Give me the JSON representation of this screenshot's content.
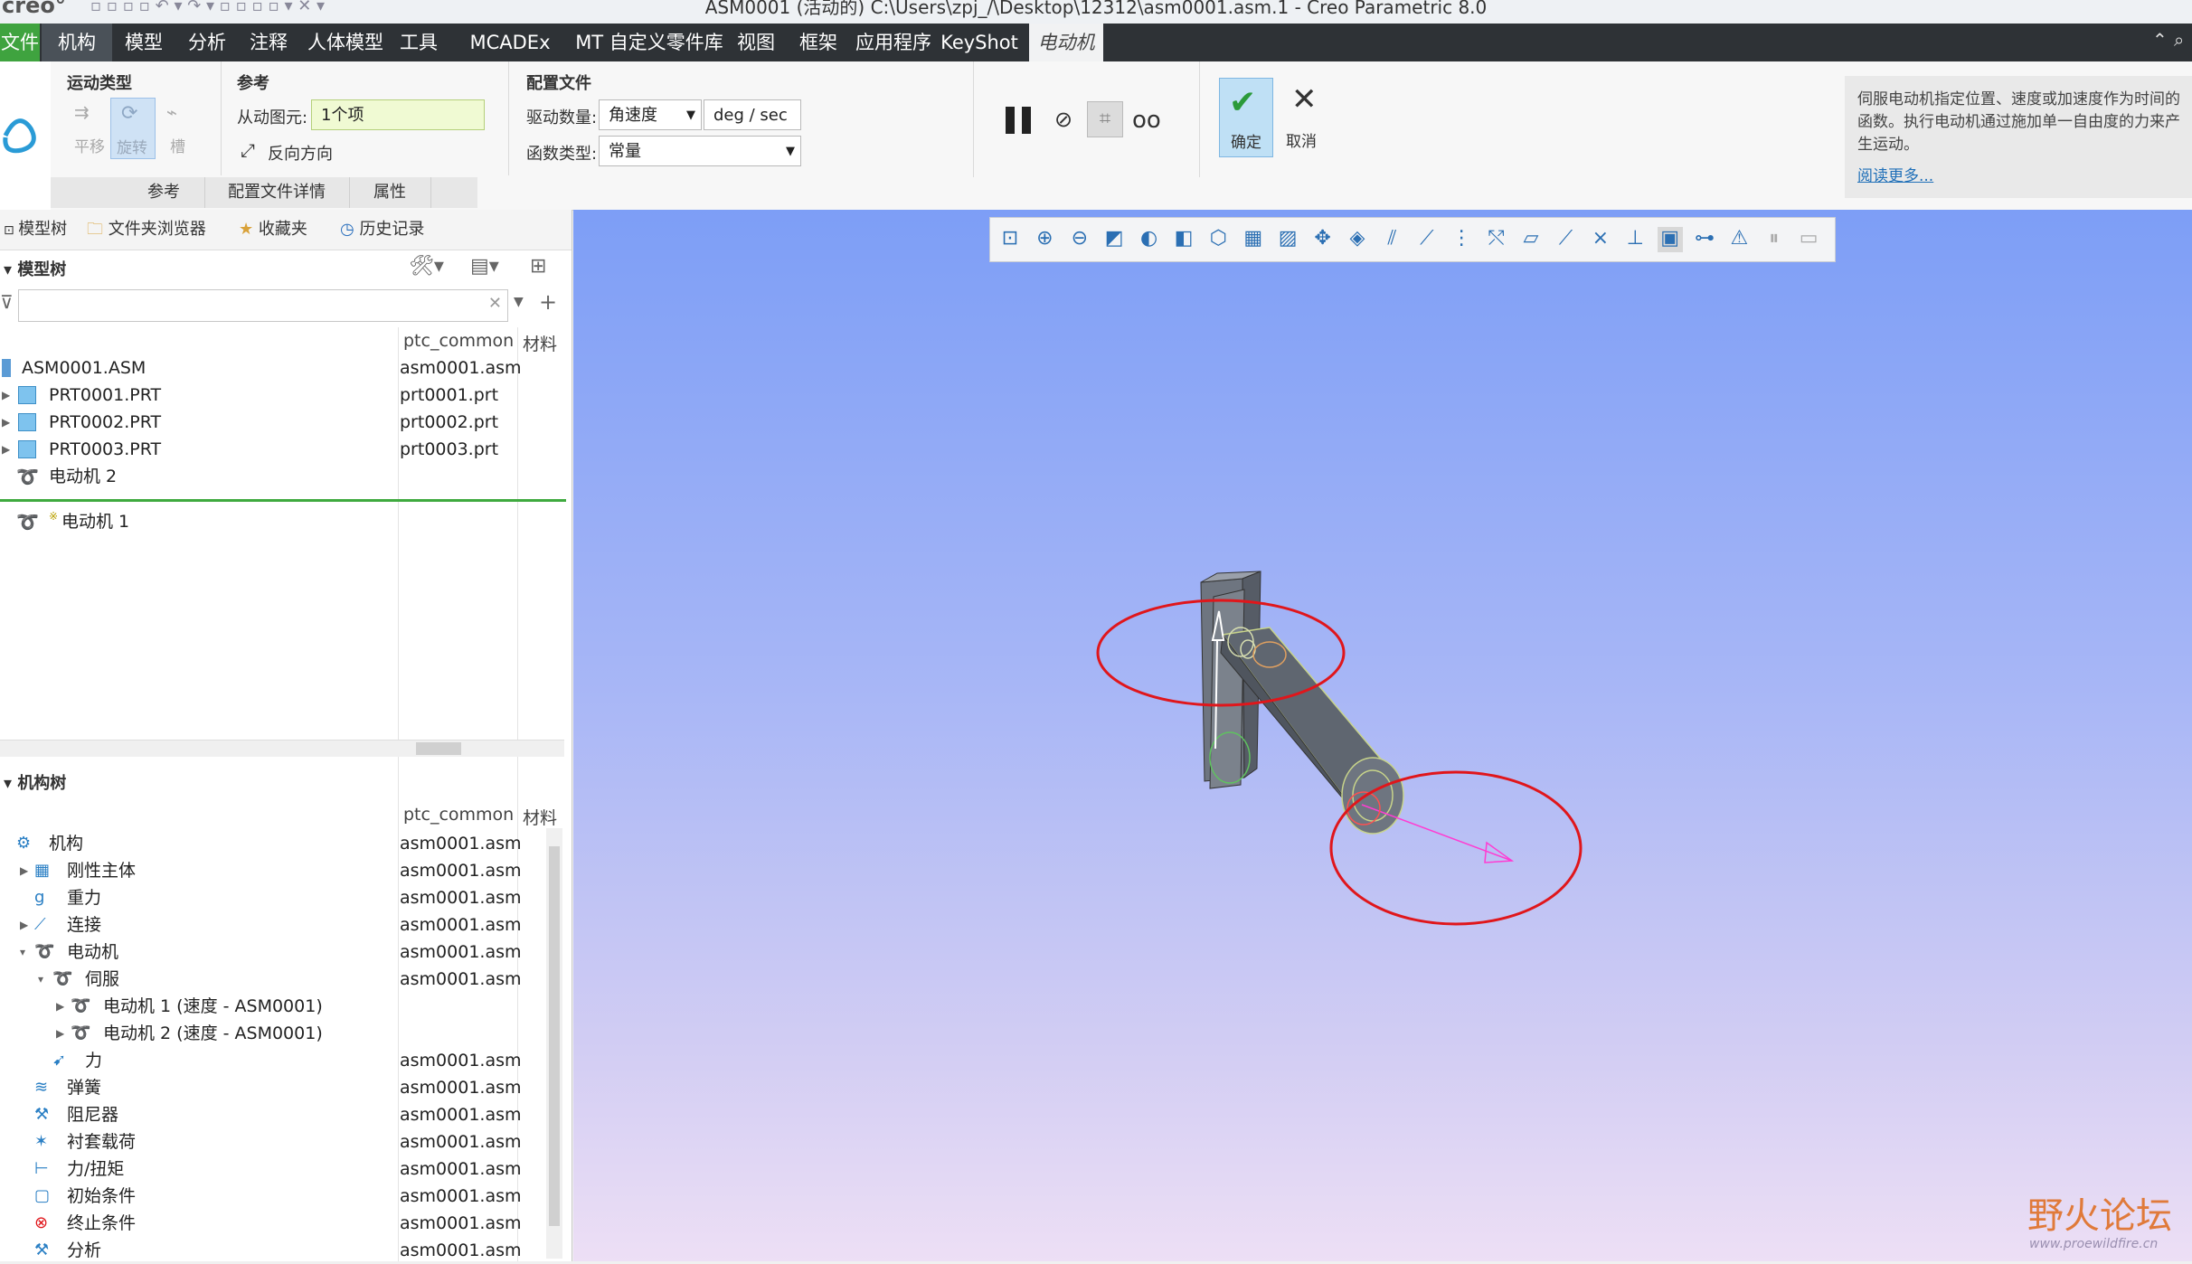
{
  "app": {
    "logo": "creo°",
    "window_title": "ASM0001 (活动的) C:\\Users\\zpj_/\\Desktop\\12312\\asm0001.asm.1 - Creo Parametric 8.0"
  },
  "menu": {
    "file": "文件",
    "items": [
      "机构",
      "模型",
      "分析",
      "注释",
      "人体模型",
      "工具",
      "MCADEx Tools",
      "MT 自定义零件库工具",
      "视图",
      "框架",
      "应用程序",
      "KeyShot"
    ],
    "active_tab": "电动机"
  },
  "ribbon": {
    "motion_type": {
      "title": "运动类型",
      "translate": "平移",
      "rotate": "旋转",
      "slot": "槽"
    },
    "reference": {
      "title": "参考",
      "driven_label": "从动图元:",
      "driven_value": "1个项",
      "reverse": "反向方向"
    },
    "profile": {
      "title": "配置文件",
      "drive_qty_label": "驱动数量:",
      "drive_qty_value": "角速度",
      "unit": "deg / sec",
      "func_type_label": "函数类型:",
      "func_type_value": "常量"
    },
    "ok": "确定",
    "cancel": "取消",
    "bottom_tabs": [
      "参考",
      "配置文件详情",
      "属性"
    ]
  },
  "help": {
    "text": "伺服电动机指定位置、速度或加速度作为时间的函数。执行电动机通过施加单一自由度的力来产生运动。",
    "link": "阅读更多..."
  },
  "nav_tabs": [
    "模型树",
    "文件夹浏览器",
    "收藏夹",
    "历史记录"
  ],
  "model_tree": {
    "title": "模型树",
    "columns": [
      "ptc_common",
      "材料"
    ],
    "rows": [
      {
        "name": "ASM0001.ASM",
        "value": "asm0001.asm"
      },
      {
        "name": "PRT0001.PRT",
        "value": "prt0001.prt"
      },
      {
        "name": "PRT0002.PRT",
        "value": "prt0002.prt"
      },
      {
        "name": "PRT0003.PRT",
        "value": "prt0003.prt"
      },
      {
        "name": "电动机 2",
        "value": ""
      }
    ],
    "inserted": "电动机 1"
  },
  "mech_tree": {
    "title": "机构树",
    "columns": [
      "ptc_common",
      "材料"
    ],
    "rows": [
      {
        "name": "机构",
        "value": "asm0001.asm"
      },
      {
        "name": "刚性主体",
        "value": "asm0001.asm"
      },
      {
        "name": "重力",
        "value": "asm0001.asm"
      },
      {
        "name": "连接",
        "value": "asm0001.asm"
      },
      {
        "name": "电动机",
        "value": "asm0001.asm"
      },
      {
        "name": "伺服",
        "value": "asm0001.asm"
      },
      {
        "name": "电动机 1 (速度 - ASM0001)",
        "value": ""
      },
      {
        "name": "电动机 2 (速度 - ASM0001)",
        "value": ""
      },
      {
        "name": "力",
        "value": "asm0001.asm"
      },
      {
        "name": "弹簧",
        "value": "asm0001.asm"
      },
      {
        "name": "阻尼器",
        "value": "asm0001.asm"
      },
      {
        "name": "衬套载荷",
        "value": "asm0001.asm"
      },
      {
        "name": "力/扭矩",
        "value": "asm0001.asm"
      },
      {
        "name": "初始条件",
        "value": "asm0001.asm"
      },
      {
        "name": "终止条件",
        "value": "asm0001.asm"
      },
      {
        "name": "分析",
        "value": "asm0001.asm"
      }
    ]
  },
  "watermark": {
    "text": "野火论坛",
    "url": "www.proewildfire.cn"
  },
  "colors": {
    "accent_green": "#3fa33f",
    "menubar": "#2e3236",
    "highlight_red": "#e0161b"
  }
}
